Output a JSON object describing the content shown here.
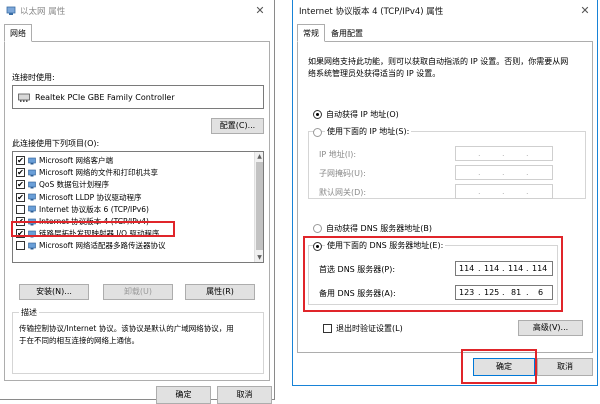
{
  "left_window": {
    "title": "以太网 属性",
    "tab": "网络",
    "connect_using_label": "连接时使用:",
    "adapter_name": "Realtek PCIe GBE Family Controller",
    "configure_button": "配置(C)...",
    "items_label": "此连接使用下列项目(O):",
    "items": [
      {
        "label": "Microsoft 网络客户端",
        "checked": true
      },
      {
        "label": "Microsoft 网络的文件和打印机共享",
        "checked": true
      },
      {
        "label": "QoS 数据包计划程序",
        "checked": true
      },
      {
        "label": "Microsoft LLDP 协议驱动程序",
        "checked": true
      },
      {
        "label": "Internet 协议版本 6 (TCP/IPv6)",
        "checked": false
      },
      {
        "label": "Internet 协议版本 4 (TCP/IPv4)",
        "checked": true
      },
      {
        "label": "链路层拓扑发现映射器 I/O 驱动程序",
        "checked": true
      },
      {
        "label": "Microsoft 网络适配器多路传送器协议",
        "checked": false
      }
    ],
    "install_button": "安装(N)...",
    "uninstall_button": "卸载(U)",
    "properties_button": "属性(R)",
    "description_label": "描述",
    "description_text_line1": "传输控制协议/Internet 协议。该协议是默认的广域网络协议，用",
    "description_text_line2": "于在不同的相互连接的网络上通信。",
    "ok_button": "确定",
    "cancel_button": "取消"
  },
  "right_window": {
    "title": "Internet 协议版本 4 (TCP/IPv4) 属性",
    "tabs": [
      "常规",
      "备用配置"
    ],
    "intro_line1": "如果网络支持此功能，则可以获取自动指派的 IP 设置。否则，你需要从网",
    "intro_line2": "络系统管理员处获得适当的 IP 设置。",
    "auto_ip_label": "自动获得 IP 地址(O)",
    "manual_ip_label": "使用下面的 IP 地址(S):",
    "ip_address_label": "IP 地址(I):",
    "subnet_label": "子网掩码(U):",
    "gateway_label": "默认网关(D):",
    "auto_dns_label": "自动获得 DNS 服务器地址(B)",
    "manual_dns_label": "使用下面的 DNS 服务器地址(E):",
    "preferred_dns_label": "首选 DNS 服务器(P):",
    "preferred_dns_octets": [
      "114",
      "114",
      "114",
      "114"
    ],
    "alternate_dns_label": "备用 DNS 服务器(A):",
    "alternate_dns_octets": [
      "123",
      "125",
      "81",
      "6"
    ],
    "validate_label": "退出时验证设置(L)",
    "advanced_button": "高级(V)...",
    "ok_button": "确定",
    "cancel_button": "取消"
  },
  "colors": {
    "highlight_red": "#e0252a",
    "window_border_active": "#1883d7",
    "button_face": "#e1e1e1"
  }
}
